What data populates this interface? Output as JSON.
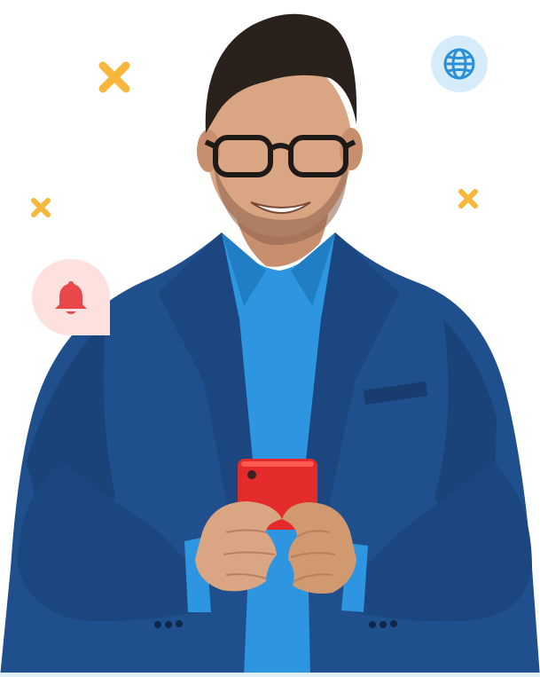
{
  "colors": {
    "background": "#ffffff",
    "cross_accent": "#f6b73c",
    "globe_badge_bg": "#d7ecfb",
    "globe_icon": "#2d8fd6",
    "bell_badge_bg": "#fde1df",
    "bell_icon": "#e8484a",
    "blazer": "#1f4f8d",
    "blazer_shadow": "#173c6d",
    "shirt": "#2e96e0",
    "shirt_shadow": "#1f7ec4",
    "skin": "#d9a583",
    "skin_shadow": "#b97f5f",
    "hair": "#2a211d",
    "glasses": "#1e1a18",
    "phone": "#e32b2b",
    "phone_highlight": "#ff5a4e",
    "bottom_line": "#dfeff8"
  },
  "icons": {
    "globe": "globe-icon",
    "bell": "bell-icon",
    "cross": "cross-icon"
  }
}
